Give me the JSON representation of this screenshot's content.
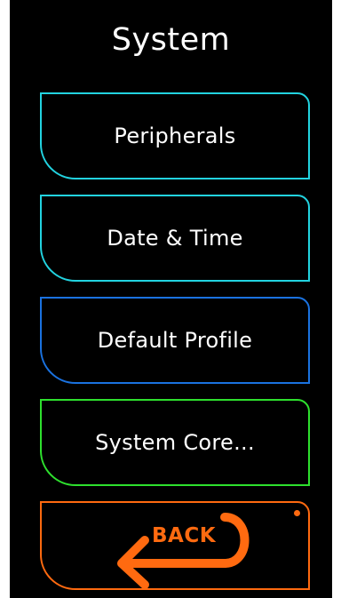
{
  "screen": {
    "title": "System"
  },
  "menu": {
    "items": [
      {
        "label": "Peripherals",
        "border_color": "#22d3e0"
      },
      {
        "label": "Date & Time",
        "border_color": "#22d3e0"
      },
      {
        "label": "Default Profile",
        "border_color": "#1a72e0"
      },
      {
        "label": "System Core...",
        "border_color": "#2ee02e"
      }
    ],
    "back": {
      "label": "BACK",
      "icon": "back-arrow-icon",
      "color": "#ff6a10"
    }
  }
}
